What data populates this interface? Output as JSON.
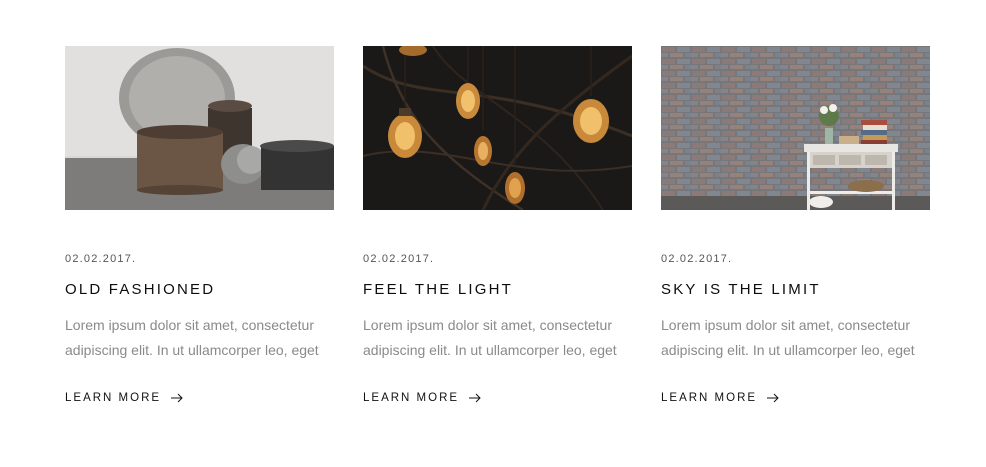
{
  "posts": [
    {
      "image": "ceramic-bowls-photo",
      "date": "02.02.2017.",
      "title": "OLD FASHIONED",
      "excerpt_line1": "Lorem ipsum dolor sit amet, consectetur",
      "excerpt_line2": "adipiscing elit. In ut ullamcorper leo, eget",
      "link": "LEARN MORE"
    },
    {
      "image": "hanging-light-bulbs-photo",
      "date": "02.02.2017.",
      "title": "FEEL THE LIGHT",
      "excerpt_line1": "Lorem ipsum dolor sit amet, consectetur",
      "excerpt_line2": "adipiscing elit. In ut ullamcorper leo, eget",
      "link": "LEARN MORE"
    },
    {
      "image": "brick-wall-shelf-photo",
      "date": "02.02.2017.",
      "title": "SKY IS THE LIMIT",
      "excerpt_line1": "Lorem ipsum dolor sit amet, consectetur",
      "excerpt_line2": "adipiscing elit. In ut ullamcorper leo, eget",
      "link": "LEARN MORE"
    }
  ],
  "arrow_icon": "arrow-right-icon"
}
